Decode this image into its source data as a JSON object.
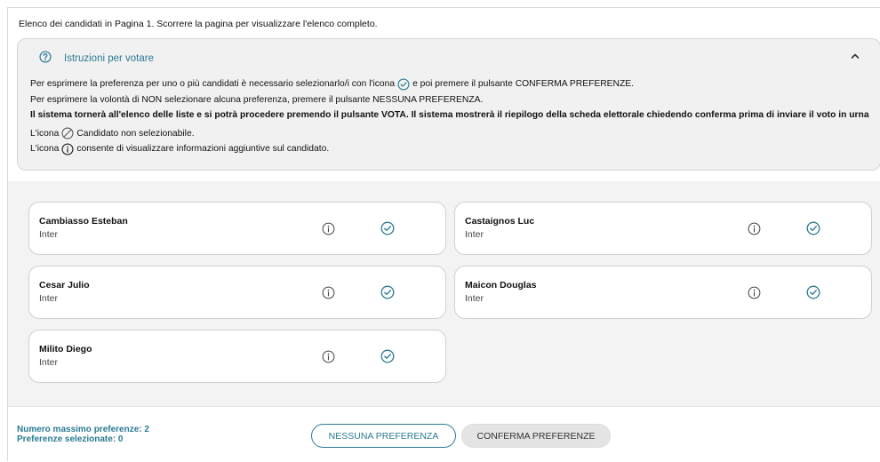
{
  "header": {
    "note": "Elenco dei candidati in Pagina 1. Scorrere la pagina per visualizzare l'elenco completo."
  },
  "instructions": {
    "title": "Istruzioni per votare",
    "line1_a": "Per esprimere la preferenza per uno o più candidati è necessario selezionarlo/i con l'icona",
    "line1_b": "e poi premere il pulsante CONFERMA PREFERENZE.",
    "line2": "Per esprimere la volontà di NON selezionare alcuna preferenza, premere il pulsante NESSUNA PREFERENZA.",
    "line3": "Il sistema tornerà all'elenco delle liste e si potrà procedere premendo il pulsante VOTA. Il sistema mostrerà il riepilogo della scheda elettorale chiedendo conferma prima di inviare il voto in urna",
    "line4_a": "L'icona",
    "line4_b": "Candidato non selezionabile.",
    "line5_a": "L'icona",
    "line5_b": "consente di visualizzare informazioni aggiuntive sul candidato."
  },
  "candidates": [
    {
      "name": "Cambiasso Esteban",
      "party": "Inter"
    },
    {
      "name": "Castaignos Luc",
      "party": "Inter"
    },
    {
      "name": "Cesar Julio",
      "party": "Inter"
    },
    {
      "name": "Maicon Douglas",
      "party": "Inter"
    },
    {
      "name": "Milito Diego",
      "party": "Inter"
    }
  ],
  "footer": {
    "max_label": "Numero massimo preferenze: 2",
    "selected_label": "Preferenze selezionate: 0",
    "none_button": "NESSUNA PREFERENZA",
    "confirm_button": "CONFERMA PREFERENZE"
  },
  "colors": {
    "accent": "#2a7b93",
    "panel": "#f1f1f1",
    "list_bg": "#f3f3f3"
  },
  "icons": [
    "help-circle-icon",
    "chevron-up-icon",
    "check-circle-icon",
    "not-allowed-icon",
    "info-icon"
  ]
}
